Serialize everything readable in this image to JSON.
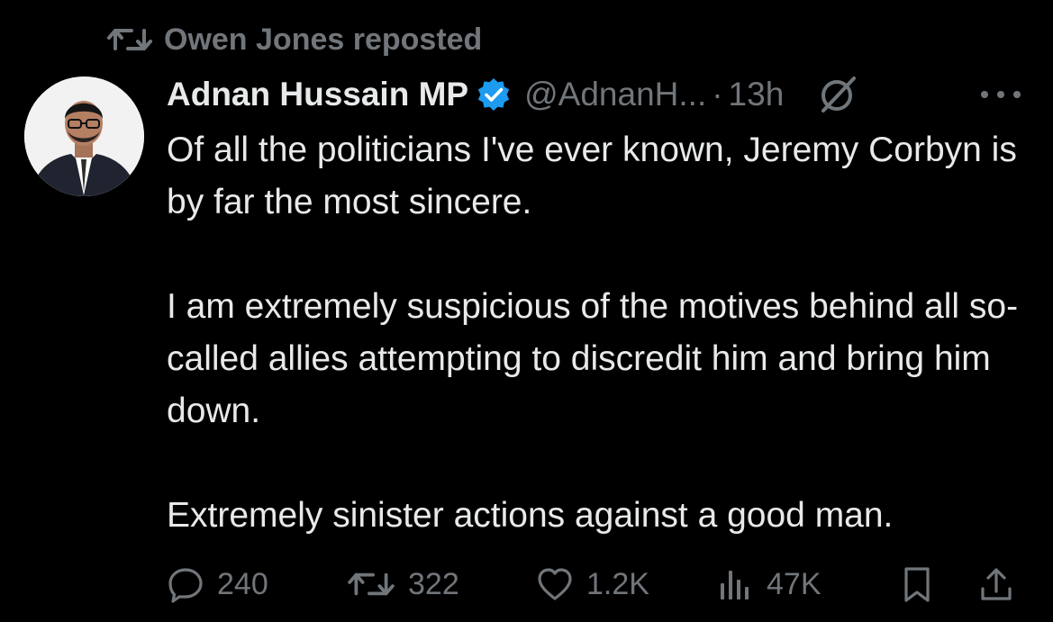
{
  "repost": {
    "label": "Owen Jones reposted"
  },
  "author": {
    "name": "Adnan Hussain MP",
    "handle": "@AdnanH...",
    "separator": "·",
    "time": "13h",
    "verified": true
  },
  "tweet": {
    "paragraphs": [
      "Of all the politicians I've ever known, Jeremy Corbyn is by far the most sincere.",
      "I am extremely suspicious of the motives behind all so-called allies attempting to discredit him and bring him down.",
      "Extremely sinister actions against a good man."
    ]
  },
  "stats": {
    "replies": "240",
    "reposts": "322",
    "likes": "1.2K",
    "views": "47K"
  },
  "icons": {
    "repost": "repost-icon",
    "verified": "verified-badge-icon",
    "grok": "grok-icon",
    "more": "more-icon",
    "reply": "reply-icon",
    "like": "heart-icon",
    "views": "analytics-icon",
    "bookmark": "bookmark-icon",
    "share": "share-icon"
  },
  "colors": {
    "background": "#000000",
    "text": "#e7e9ea",
    "muted": "#71767b",
    "verified": "#1d9bf0"
  }
}
